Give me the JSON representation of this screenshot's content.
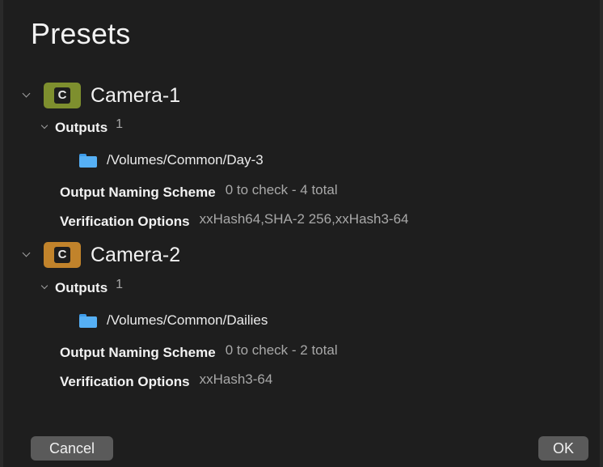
{
  "window": {
    "title": "Presets"
  },
  "presets": [
    {
      "badge_letter": "C",
      "badge_color": "#7e8f2e",
      "name": "Camera-1",
      "outputs_label": "Outputs",
      "outputs_count": "1",
      "output_path": "/Volumes/Common/Day-3",
      "naming_label": "Output Naming Scheme",
      "naming_value": "0 to check - 4 total",
      "verification_label": "Verification Options",
      "verification_value": "xxHash64,SHA-2 256,xxHash3-64"
    },
    {
      "badge_letter": "C",
      "badge_color": "#c1832b",
      "name": "Camera-2",
      "outputs_label": "Outputs",
      "outputs_count": "1",
      "output_path": "/Volumes/Common/Dailies",
      "naming_label": "Output Naming Scheme",
      "naming_value": "0 to check - 2 total",
      "verification_label": "Verification Options",
      "verification_value": "xxHash3-64"
    }
  ],
  "buttons": {
    "cancel": "Cancel",
    "ok": "OK"
  }
}
